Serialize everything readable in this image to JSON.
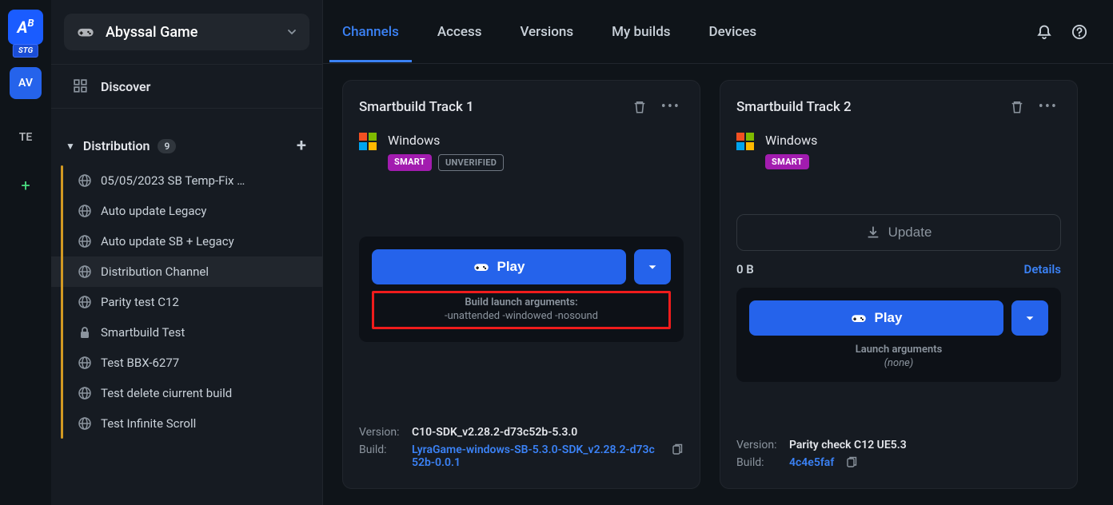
{
  "rail": {
    "stg_badge": "STG",
    "workspaces": [
      {
        "key": "AV",
        "active": true
      },
      {
        "key": "TE",
        "active": false
      }
    ]
  },
  "project": {
    "name": "Abyssal Game"
  },
  "sidebar": {
    "discover": "Discover",
    "section_title": "Distribution",
    "section_count": "9",
    "items": [
      {
        "label": "05/05/2023 SB Temp-Fix …",
        "icon": "globe"
      },
      {
        "label": "Auto update Legacy",
        "icon": "globe"
      },
      {
        "label": "Auto update SB + Legacy",
        "icon": "globe"
      },
      {
        "label": "Distribution Channel",
        "icon": "globe",
        "active": true
      },
      {
        "label": "Parity test C12",
        "icon": "globe"
      },
      {
        "label": "Smartbuild Test",
        "icon": "lock"
      },
      {
        "label": "Test BBX-6277",
        "icon": "globe"
      },
      {
        "label": "Test delete ciurrent build",
        "icon": "globe"
      },
      {
        "label": "Test Infinite Scroll",
        "icon": "globe"
      }
    ]
  },
  "tabs": {
    "items": [
      "Channels",
      "Access",
      "Versions",
      "My builds",
      "Devices"
    ],
    "active_index": 0
  },
  "cards": [
    {
      "title": "Smartbuild Track 1",
      "platform": "Windows",
      "badges": {
        "smart": "SMART",
        "unverified": "UNVERIFIED"
      },
      "play_label": "Play",
      "launch_title": "Build launch arguments:",
      "launch_value": "-unattended -windowed -nosound",
      "version_label": "Version:",
      "version_value": "C10-SDK_v2.28.2-d73c52b-5.3.0",
      "build_label": "Build:",
      "build_value": "LyraGame-windows-SB-5.3.0-SDK_v2.28.2-d73c52b-0.0.1"
    },
    {
      "title": "Smartbuild Track 2",
      "platform": "Windows",
      "badges": {
        "smart": "SMART"
      },
      "update_label": "Update",
      "size": "0 B",
      "details_label": "Details",
      "play_label": "Play",
      "launch_title": "Launch arguments",
      "launch_value": "(none)",
      "version_label": "Version:",
      "version_value": "Parity check C12 UE5.3",
      "build_label": "Build:",
      "build_value": "4c4e5faf"
    }
  ]
}
